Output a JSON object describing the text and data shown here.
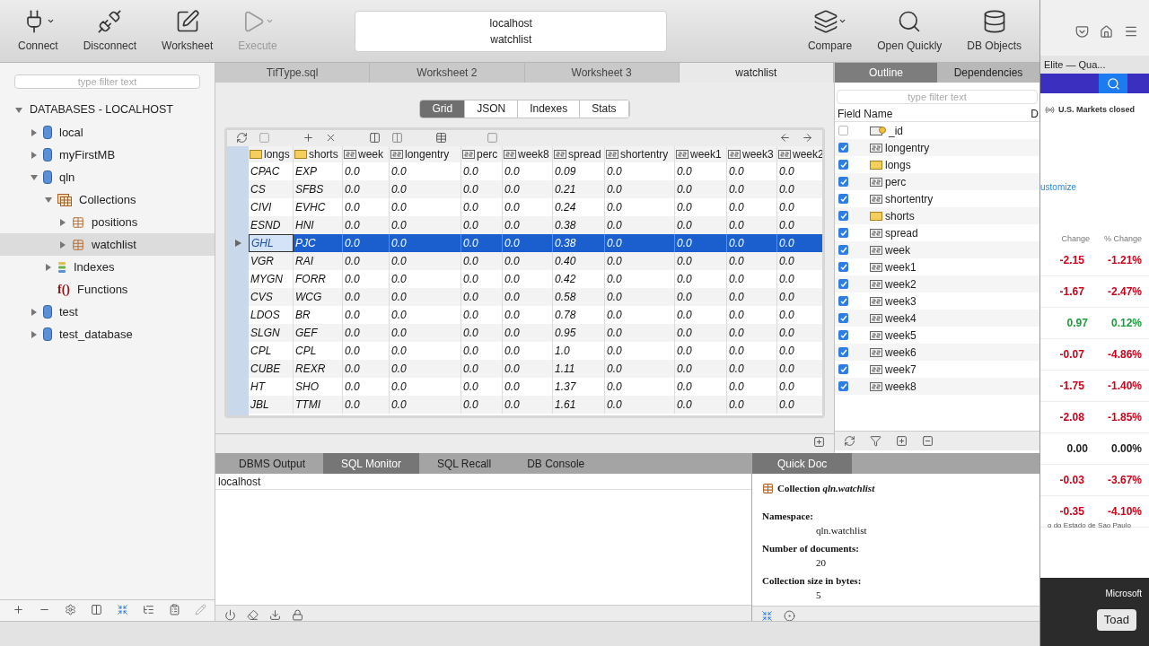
{
  "toolbar": {
    "left": [
      {
        "label": "Connect",
        "menu": true,
        "disabled": false
      },
      {
        "label": "Disconnect",
        "menu": false,
        "disabled": false
      },
      {
        "label": "Worksheet",
        "menu": false,
        "disabled": false
      },
      {
        "label": "Execute",
        "menu": true,
        "disabled": true
      }
    ],
    "connection": {
      "host": "localhost",
      "object": "watchlist"
    },
    "right": [
      {
        "label": "Compare",
        "menu": true,
        "disabled": false
      },
      {
        "label": "Open Quickly",
        "menu": false,
        "disabled": false
      },
      {
        "label": "DB Objects",
        "menu": false,
        "disabled": false
      }
    ]
  },
  "navigator": {
    "filter_placeholder": "type filter text",
    "root": {
      "label": "DATABASES - LOCALHOST",
      "expanded": true,
      "children": [
        {
          "label": "local",
          "kind": "database",
          "expanded": false,
          "selected": false
        },
        {
          "label": "myFirstMB",
          "kind": "database",
          "expanded": false,
          "selected": false
        },
        {
          "label": "qln",
          "kind": "database",
          "expanded": true,
          "selected": false,
          "children": [
            {
              "label": "Collections",
              "kind": "collections",
              "expanded": true,
              "selected": false,
              "children": [
                {
                  "label": "positions",
                  "kind": "collection",
                  "expanded": false,
                  "selected": false
                },
                {
                  "label": "watchlist",
                  "kind": "collection",
                  "expanded": false,
                  "selected": true
                }
              ]
            },
            {
              "label": "Indexes",
              "kind": "indexes",
              "expanded": false,
              "selected": false
            },
            {
              "label": "Functions",
              "kind": "functions",
              "icon_text": "f()",
              "selected": false
            }
          ]
        },
        {
          "label": "test",
          "kind": "database",
          "expanded": false,
          "selected": false
        },
        {
          "label": "test_database",
          "kind": "database",
          "expanded": false,
          "selected": false
        }
      ]
    }
  },
  "editor_tabs": [
    {
      "label": "TifType.sql",
      "selected": false
    },
    {
      "label": "Worksheet 2",
      "selected": false
    },
    {
      "label": "Worksheet 3",
      "selected": false
    },
    {
      "label": "watchlist",
      "selected": true
    }
  ],
  "view_tabs": [
    {
      "label": "Grid",
      "selected": true
    },
    {
      "label": "JSON",
      "selected": false
    },
    {
      "label": "Indexes",
      "selected": false
    },
    {
      "label": "Stats",
      "selected": false
    }
  ],
  "grid": {
    "columns": [
      {
        "name": "longs",
        "kind": "string"
      },
      {
        "name": "shorts",
        "kind": "string"
      },
      {
        "name": "week",
        "kind": "number"
      },
      {
        "name": "longentry",
        "kind": "number"
      },
      {
        "name": "perc",
        "kind": "number"
      },
      {
        "name": "week8",
        "kind": "number"
      },
      {
        "name": "spread",
        "kind": "number"
      },
      {
        "name": "shortentry",
        "kind": "number"
      },
      {
        "name": "week1",
        "kind": "number"
      },
      {
        "name": "week3",
        "kind": "number"
      },
      {
        "name": "week2",
        "kind": "number"
      }
    ],
    "rows": [
      {
        "selected": false,
        "cells": [
          "CPAC",
          "EXP",
          "0.0",
          "0.0",
          "0.0",
          "0.0",
          "0.09",
          "0.0",
          "0.0",
          "0.0",
          "0.0"
        ]
      },
      {
        "selected": false,
        "cells": [
          "CS",
          "SFBS",
          "0.0",
          "0.0",
          "0.0",
          "0.0",
          "0.21",
          "0.0",
          "0.0",
          "0.0",
          "0.0"
        ]
      },
      {
        "selected": false,
        "cells": [
          "CIVI",
          "EVHC",
          "0.0",
          "0.0",
          "0.0",
          "0.0",
          "0.24",
          "0.0",
          "0.0",
          "0.0",
          "0.0"
        ]
      },
      {
        "selected": false,
        "cells": [
          "ESND",
          "HNI",
          "0.0",
          "0.0",
          "0.0",
          "0.0",
          "0.38",
          "0.0",
          "0.0",
          "0.0",
          "0.0"
        ]
      },
      {
        "selected": true,
        "cells": [
          "GHL",
          "PJC",
          "0.0",
          "0.0",
          "0.0",
          "0.0",
          "0.38",
          "0.0",
          "0.0",
          "0.0",
          "0.0"
        ]
      },
      {
        "selected": false,
        "cells": [
          "VGR",
          "RAI",
          "0.0",
          "0.0",
          "0.0",
          "0.0",
          "0.40",
          "0.0",
          "0.0",
          "0.0",
          "0.0"
        ]
      },
      {
        "selected": false,
        "cells": [
          "MYGN",
          "FORR",
          "0.0",
          "0.0",
          "0.0",
          "0.0",
          "0.42",
          "0.0",
          "0.0",
          "0.0",
          "0.0"
        ]
      },
      {
        "selected": false,
        "cells": [
          "CVS",
          "WCG",
          "0.0",
          "0.0",
          "0.0",
          "0.0",
          "0.58",
          "0.0",
          "0.0",
          "0.0",
          "0.0"
        ]
      },
      {
        "selected": false,
        "cells": [
          "LDOS",
          "BR",
          "0.0",
          "0.0",
          "0.0",
          "0.0",
          "0.78",
          "0.0",
          "0.0",
          "0.0",
          "0.0"
        ]
      },
      {
        "selected": false,
        "cells": [
          "SLGN",
          "GEF",
          "0.0",
          "0.0",
          "0.0",
          "0.0",
          "0.95",
          "0.0",
          "0.0",
          "0.0",
          "0.0"
        ]
      },
      {
        "selected": false,
        "cells": [
          "CPL",
          "CPL",
          "0.0",
          "0.0",
          "0.0",
          "0.0",
          "1.0",
          "0.0",
          "0.0",
          "0.0",
          "0.0"
        ]
      },
      {
        "selected": false,
        "cells": [
          "CUBE",
          "REXR",
          "0.0",
          "0.0",
          "0.0",
          "0.0",
          "1.11",
          "0.0",
          "0.0",
          "0.0",
          "0.0"
        ]
      },
      {
        "selected": false,
        "cells": [
          "HT",
          "SHO",
          "0.0",
          "0.0",
          "0.0",
          "0.0",
          "1.37",
          "0.0",
          "0.0",
          "0.0",
          "0.0"
        ]
      },
      {
        "selected": false,
        "cells": [
          "JBL",
          "TTMI",
          "0.0",
          "0.0",
          "0.0",
          "0.0",
          "1.61",
          "0.0",
          "0.0",
          "0.0",
          "0.0"
        ]
      }
    ]
  },
  "outline": {
    "tabs": [
      {
        "label": "Outline",
        "selected": true
      },
      {
        "label": "Dependencies",
        "selected": false
      }
    ],
    "filter_placeholder": "type filter text",
    "header": "Field Name",
    "header_2": "D",
    "fields": [
      {
        "name": "_id",
        "kind": "id",
        "checked": false
      },
      {
        "name": "longentry",
        "kind": "number",
        "checked": true
      },
      {
        "name": "longs",
        "kind": "string",
        "checked": true
      },
      {
        "name": "perc",
        "kind": "number",
        "checked": true
      },
      {
        "name": "shortentry",
        "kind": "number",
        "checked": true
      },
      {
        "name": "shorts",
        "kind": "string",
        "checked": true
      },
      {
        "name": "spread",
        "kind": "number",
        "checked": true
      },
      {
        "name": "week",
        "kind": "number",
        "checked": true
      },
      {
        "name": "week1",
        "kind": "number",
        "checked": true
      },
      {
        "name": "week2",
        "kind": "number",
        "checked": true
      },
      {
        "name": "week3",
        "kind": "number",
        "checked": true
      },
      {
        "name": "week4",
        "kind": "number",
        "checked": true
      },
      {
        "name": "week5",
        "kind": "number",
        "checked": true
      },
      {
        "name": "week6",
        "kind": "number",
        "checked": true
      },
      {
        "name": "week7",
        "kind": "number",
        "checked": true
      },
      {
        "name": "week8",
        "kind": "number",
        "checked": true
      }
    ]
  },
  "output_tabs": [
    {
      "label": "DBMS Output",
      "selected": false
    },
    {
      "label": "SQL Monitor",
      "selected": true
    },
    {
      "label": "SQL Recall",
      "selected": false
    },
    {
      "label": "DB Console",
      "selected": false
    }
  ],
  "monitor_lines": [
    "localhost"
  ],
  "quick_doc": {
    "tab": "Quick Doc",
    "title": "Collection *qln.watchlist*",
    "entries": [
      {
        "label": "Namespace:",
        "value": "qln.watchlist"
      },
      {
        "label": "Number of documents:",
        "value": "20"
      },
      {
        "label": "Collection size in bytes:",
        "value": "5"
      }
    ]
  },
  "browser": {
    "title": "Elite — Qua...",
    "market_status": "U.S. Markets closed",
    "link": "ustomize",
    "headers": [
      "Change",
      "% Change"
    ],
    "quotes": [
      {
        "change": "-2.15",
        "percent": "-1.21%",
        "color": "#d0021b"
      },
      {
        "change": "-1.67",
        "percent": "-2.47%",
        "color": "#d0021b"
      },
      {
        "change": "0.97",
        "percent": "0.12%",
        "color": "#1a9e3a"
      },
      {
        "change": "-0.07",
        "percent": "-4.86%",
        "color": "#d0021b"
      },
      {
        "change": "-1.75",
        "percent": "-1.40%",
        "color": "#d0021b"
      },
      {
        "change": "-2.08",
        "percent": "-1.85%",
        "color": "#d0021b"
      },
      {
        "change": "0.00",
        "percent": "0.00%",
        "color": "#222222"
      },
      {
        "change": "-0.03",
        "percent": "-3.67%",
        "color": "#d0021b"
      },
      {
        "change": "-0.35",
        "percent": "-4.10%",
        "color": "#d0021b"
      }
    ],
    "footnote": "o do Estado de Sao Paulo",
    "ad_brand": "Microsoft",
    "ad_button": "Toad"
  }
}
